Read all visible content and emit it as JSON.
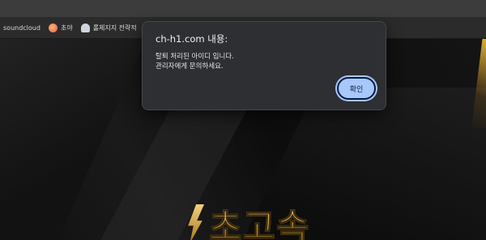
{
  "bookmarks": [
    {
      "label": "soundcloud",
      "icon": ""
    },
    {
      "label": "초야",
      "icon": "choya-icon"
    },
    {
      "label": "롤체지지 전략적",
      "icon": "ghost-icon"
    }
  ],
  "dialog": {
    "title": "ch-h1.com 내용:",
    "message_line1": "탈퇴 처리된 아이디 입니다.",
    "message_line2": "관리자에게 문의하세요.",
    "ok_label": "확인"
  },
  "logo": {
    "text": "초고속"
  },
  "colors": {
    "ok_button": "#a8c7fa",
    "dialog_bg": "#2d2f33",
    "gold": "#c59638"
  }
}
